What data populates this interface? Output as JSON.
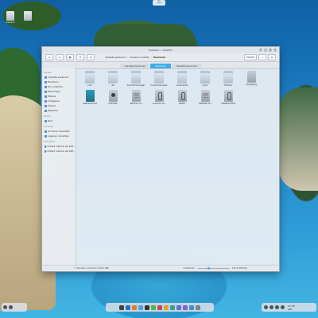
{
  "top_indicator": {
    "line1": "BIS",
    "line2": "OFEK"
  },
  "desktop": {
    "icons": [
      {
        "label": "Kuanium",
        "icon": "drive-icon"
      },
      {
        "label": "",
        "icon": "document-icon"
      }
    ]
  },
  "window": {
    "title": "Kuanium — Dolphin",
    "controls": [
      "?",
      "–",
      "□",
      "×"
    ],
    "toolbar": {
      "back": "◂",
      "forward": "▸",
      "view_icons": "▦",
      "view_list": "☰",
      "view_tree": "≡",
      "breadcrumb": [
        "Carpeta personal",
        "Kuanium-master",
        "Kuanium"
      ],
      "divide_label": "Dividir",
      "search_icon": "search-icon",
      "menu_icon": "menu-icon"
    },
    "tabs": [
      "Carpeta personal",
      "Kuanium",
      "Carpeta personal"
    ],
    "active_tab": 1,
    "sidebar": {
      "sections": [
        {
          "title": "Lugares",
          "items": [
            "Carpeta personal",
            "Escritorio",
            "Documentos",
            "Descargas",
            "Música",
            "Imágenes",
            "Vídeos",
            "Papelera"
          ]
        },
        {
          "title": "Remoto",
          "items": [
            "Red"
          ]
        },
        {
          "title": "Recientes",
          "items": [
            "Archivos recientes",
            "Lugares recientes"
          ]
        },
        {
          "title": "Dispositivos",
          "items": [
            "Unidad interna de 100...",
            "Unidad interna de 100..."
          ]
        }
      ]
    },
    "files": [
      {
        "name": "color",
        "kind": "folder"
      },
      {
        "name": "dsl",
        "kind": "folder"
      },
      {
        "name": "kvantummanager",
        "kind": "folder"
      },
      {
        "name": "kvantumpreview",
        "kind": "folder"
      },
      {
        "name": "screenshots",
        "kind": "folder"
      },
      {
        "name": "style",
        "kind": "folder"
      },
      {
        "name": "themes",
        "kind": "folder"
      },
      {
        "name": "ChangeLog",
        "kind": "doc"
      },
      {
        "name": "CMakeLists.txt",
        "kind": "blue"
      },
      {
        "name": "COPYING",
        "kind": "dark"
      },
      {
        "name": "INSTALL.md",
        "kind": "lines"
      },
      {
        "name": "kvantum.pro",
        "kind": "clip"
      },
      {
        "name": "NEWS",
        "kind": "clip"
      },
      {
        "name": "README.md",
        "kind": "lines"
      },
      {
        "name": "TRANSLATION",
        "kind": "clip"
      }
    ],
    "status": {
      "summary": "7 carpetas, 8 archivos (121,0 KiB)",
      "zoom_label": "Ampliación:",
      "zoom_level": 0.3,
      "free_space": "133,4 GiB libre"
    }
  },
  "dock": {
    "apps": [
      "settings-icon",
      "files-icon",
      "browser-icon",
      "photo-icon",
      "terminal-icon",
      "chat-icon",
      "video-icon",
      "music-icon",
      "store-icon",
      "mail-icon",
      "image-icon",
      "editor-icon",
      "trash-icon"
    ]
  },
  "tray": {
    "clock_line1": "17:38",
    "clock_line2": "sáb"
  }
}
